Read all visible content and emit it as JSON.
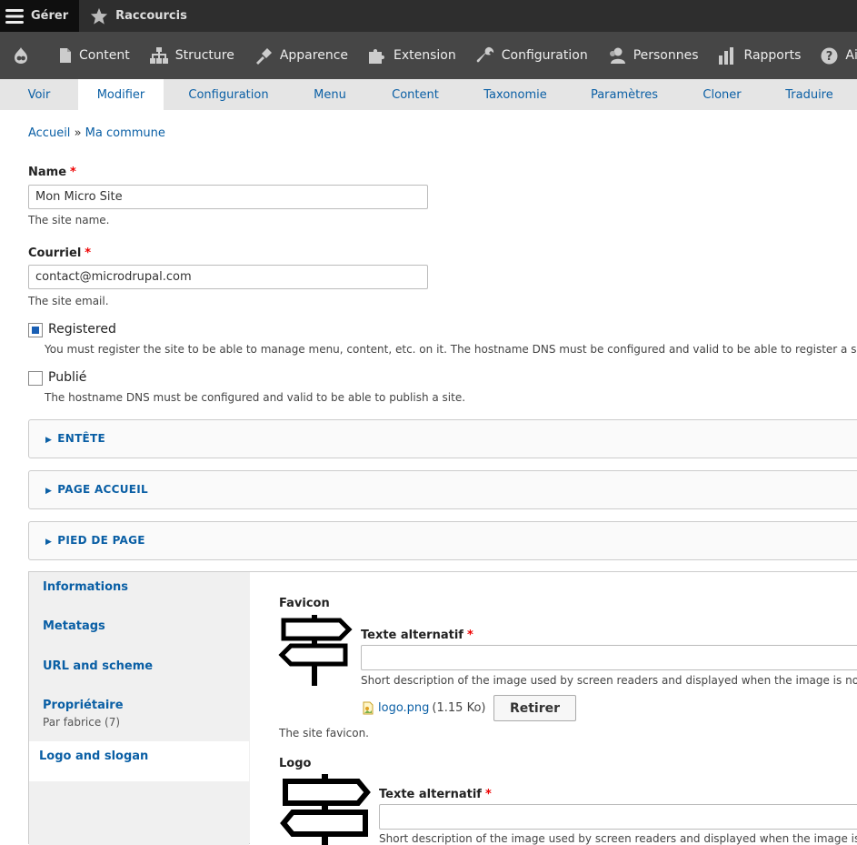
{
  "toolbar_top": {
    "manage_label": "Gérer",
    "shortcuts_label": "Raccourcis"
  },
  "toolbar_admin": {
    "items": [
      {
        "label": "Content",
        "icon": "file-icon"
      },
      {
        "label": "Structure",
        "icon": "structure-icon"
      },
      {
        "label": "Apparence",
        "icon": "brush-icon"
      },
      {
        "label": "Extension",
        "icon": "puzzle-icon"
      },
      {
        "label": "Configuration",
        "icon": "wrench-icon"
      },
      {
        "label": "Personnes",
        "icon": "people-icon"
      },
      {
        "label": "Rapports",
        "icon": "bar-chart-icon"
      },
      {
        "label": "Aide",
        "icon": "help-icon"
      }
    ]
  },
  "tabs": [
    {
      "label": "Voir",
      "active": false
    },
    {
      "label": "Modifier",
      "active": true
    },
    {
      "label": "Configuration",
      "active": false
    },
    {
      "label": "Menu",
      "active": false
    },
    {
      "label": "Content",
      "active": false
    },
    {
      "label": "Taxonomie",
      "active": false
    },
    {
      "label": "Paramètres",
      "active": false
    },
    {
      "label": "Cloner",
      "active": false
    },
    {
      "label": "Traduire",
      "active": false
    }
  ],
  "breadcrumb": {
    "home": "Accueil",
    "separator": "»",
    "current": "Ma commune"
  },
  "form": {
    "name": {
      "label": "Name",
      "required": "*",
      "value": "Mon Micro Site",
      "help": "The site name."
    },
    "email": {
      "label": "Courriel",
      "required": "*",
      "value": "contact@microdrupal.com",
      "help": "The site email."
    },
    "registered": {
      "label": "Registered",
      "checked": true,
      "help": "You must register the site to be able to manage menu, content, etc. on it. The hostname DNS must be configured and valid to be able to register a site."
    },
    "published": {
      "label": "Publié",
      "checked": false,
      "help": "The hostname DNS must be configured and valid to be able to publish a site."
    }
  },
  "details": [
    {
      "label": "ENTÊTE"
    },
    {
      "label": "PAGE ACCUEIL"
    },
    {
      "label": "PIED DE PAGE"
    }
  ],
  "vertical_tabs": {
    "items": [
      {
        "label": "Informations",
        "summary": ""
      },
      {
        "label": "Metatags",
        "summary": ""
      },
      {
        "label": "URL and scheme",
        "summary": ""
      },
      {
        "label": "Propriétaire",
        "summary": "Par fabrice (7)"
      },
      {
        "label": "Logo and slogan",
        "summary": "",
        "active": true
      }
    ]
  },
  "logo_pane": {
    "favicon": {
      "label": "Favicon",
      "alt_label": "Texte alternatif",
      "alt_required": "*",
      "alt_value": "",
      "alt_help": "Short description of the image used by screen readers and displayed when the image is not loa",
      "file_name": "logo.png",
      "file_size": "(1.15 Ko)",
      "remove_label": "Retirer",
      "help": "The site favicon."
    },
    "logo": {
      "label": "Logo",
      "alt_label": "Texte alternatif",
      "alt_required": "*",
      "alt_value": "",
      "alt_help": "Short description of the image used by screen readers and displayed when the image is not"
    }
  },
  "colors": {
    "toolbar_dark": "#2e2e2e",
    "toolbar_admin": "#464646",
    "tabs_bg": "#e5e5e5",
    "link": "#0a5fa5",
    "required": "#e00000",
    "checkbox_checked": "#1a5fb4"
  }
}
